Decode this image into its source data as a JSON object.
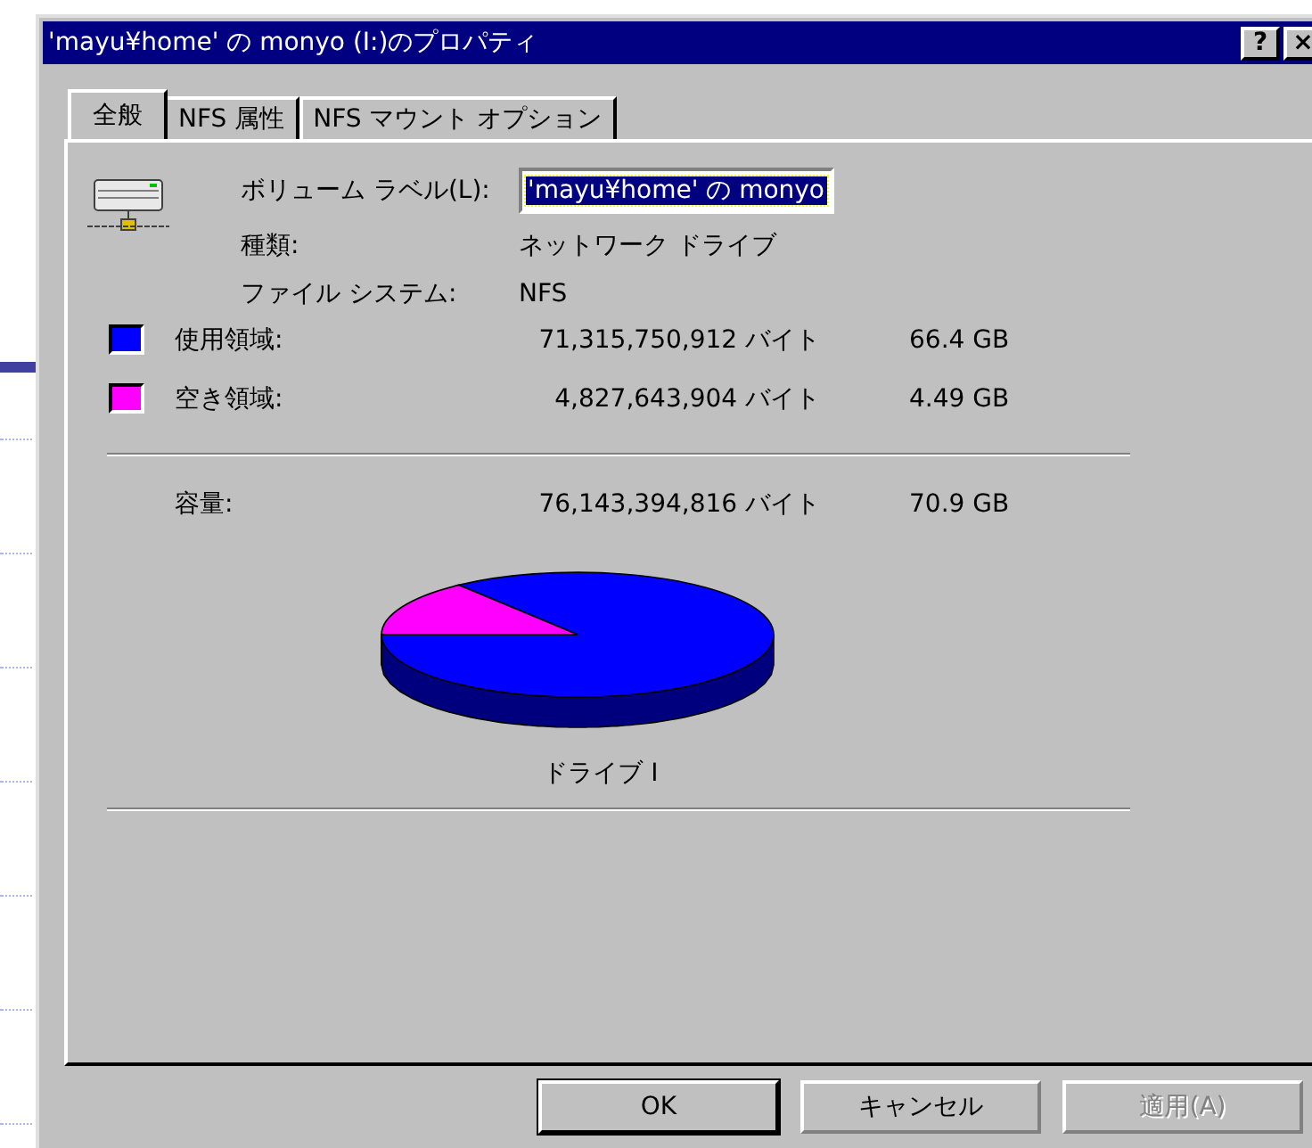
{
  "window": {
    "title": "'mayu¥home' の monyo (I:)のプロパティ",
    "buttons": [
      "?",
      "×"
    ]
  },
  "tabs": [
    {
      "label": "全般",
      "selected": true
    },
    {
      "label": "NFS 属性",
      "selected": false
    },
    {
      "label": "NFS マウント オプション",
      "selected": false
    }
  ],
  "general": {
    "volume_label": {
      "label": "ボリューム ラベル(L):",
      "value": "'mayu¥home' の monyo",
      "selected": true
    },
    "info": [
      {
        "label": "種類:",
        "value": "ネットワーク ドライブ"
      },
      {
        "label": "ファイル システム:",
        "value": "NFS"
      }
    ],
    "space": [
      {
        "label": "使用領域:",
        "bytes": "71,315,750,912 バイト",
        "size": "66.4 GB",
        "color": "#0000ff"
      },
      {
        "label": "空き領域:",
        "bytes": "4,827,643,904 バイト",
        "size": "4.49 GB",
        "color": "#ff00ff"
      }
    ],
    "capacity": {
      "label": "容量:",
      "bytes": "76,143,394,816 バイト",
      "size": "70.9 GB"
    },
    "pie": {
      "kind": "picture",
      "caption": "ドライブ I"
    }
  },
  "buttons": [
    {
      "label": "OK",
      "default": true,
      "disabled": false
    },
    {
      "label": "キャンセル",
      "default": false,
      "disabled": false
    },
    {
      "label": "適用(A)",
      "default": false,
      "disabled": true
    }
  ]
}
